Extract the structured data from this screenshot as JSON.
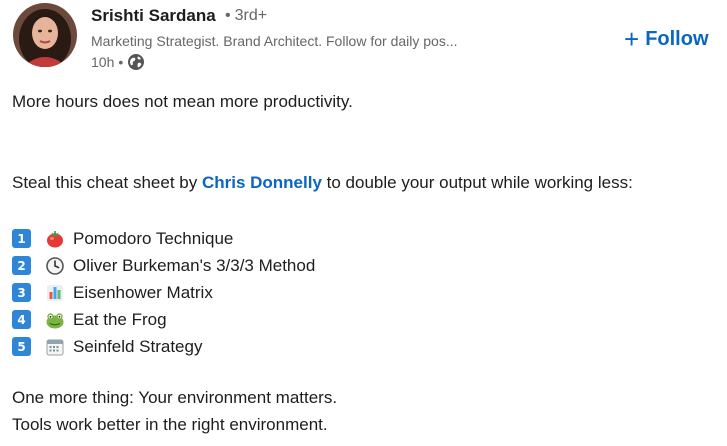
{
  "author": {
    "name": "Srishti Sardana",
    "degree_sep": "•",
    "degree": "3rd+",
    "headline": "Marketing Strategist. Brand Architect. Follow for daily pos...",
    "time": "10h",
    "meta_sep": "•",
    "visibility_icon": "globe-icon"
  },
  "follow": {
    "icon": "+",
    "label": "Follow",
    "color": "#0a66c2"
  },
  "post": {
    "line1": "More hours does not mean more productivity.",
    "intro_before": "Steal this cheat sheet by ",
    "mention": "Chris Donnelly",
    "intro_after": " to double your output while working less:",
    "items": [
      {
        "number": "1",
        "icon": "tomato-icon",
        "label": "Pomodoro Technique"
      },
      {
        "number": "2",
        "icon": "clock-icon",
        "label": "Oliver Burkeman's 3/3/3 Method"
      },
      {
        "number": "3",
        "icon": "bar-chart-icon",
        "label": "Eisenhower Matrix"
      },
      {
        "number": "4",
        "icon": "frog-icon",
        "label": "Eat the Frog"
      },
      {
        "number": "5",
        "icon": "calendar-icon",
        "label": "Seinfeld Strategy"
      }
    ],
    "closing1": "One more thing: Your environment matters.",
    "closing2": "Tools work better in the right environment."
  }
}
